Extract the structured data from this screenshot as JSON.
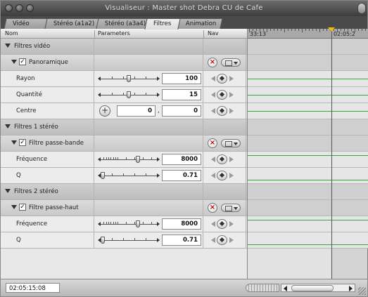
{
  "window": {
    "title": "Visualiseur : Master shot Debra CU de Cafe"
  },
  "tabs": [
    {
      "label": "Vidéo"
    },
    {
      "label": "Stéréo (a1a2)"
    },
    {
      "label": "Stéréo (a3a4)"
    },
    {
      "label": "Filtres",
      "active": true
    },
    {
      "label": "Animation"
    }
  ],
  "columns": {
    "name": "Nom",
    "parameters": "Parameters",
    "nav": "Nav"
  },
  "ruler": {
    "start": "33:13",
    "end": "02:05:2"
  },
  "rows": {
    "filtres_video": "Filtres vidéo",
    "panoramique": "Panoramique",
    "rayon": {
      "label": "Rayon",
      "value": "100",
      "slider_fraction": 0.5
    },
    "quantite": {
      "label": "Quantité",
      "value": "15",
      "slider_fraction": 0.5
    },
    "centre": {
      "label": "Centre",
      "x": "0",
      "y": "0",
      "separator": ","
    },
    "filtres_1_stereo": "Filtres 1 stéréo",
    "filtre_passe_bande": "Filtre passe-bande",
    "frequence_1": {
      "label": "Fréquence",
      "value": "8000",
      "slider_fraction": 0.68
    },
    "q_1": {
      "label": "Q",
      "value": "0.71",
      "slider_fraction": 0.0
    },
    "filtres_2_stereo": "Filtres 2 stéréo",
    "filtre_passe_haut": "Filtre passe-haut",
    "frequence_2": {
      "label": "Fréquence",
      "value": "8000",
      "slider_fraction": 0.68
    },
    "q_2": {
      "label": "Q",
      "value": "0.71",
      "slider_fraction": 0.0
    }
  },
  "icons": {
    "reset": "x-circle-icon",
    "menu": "keyframe-menu-icon",
    "keyframe": "diamond-keyframe-icon",
    "check": "✓"
  },
  "colors": {
    "keyframe_line": "#3aa63a",
    "playhead_marker": "#e8c200",
    "reset_x": "#c00000"
  },
  "bottom": {
    "timecode": "02:05:15:08"
  }
}
